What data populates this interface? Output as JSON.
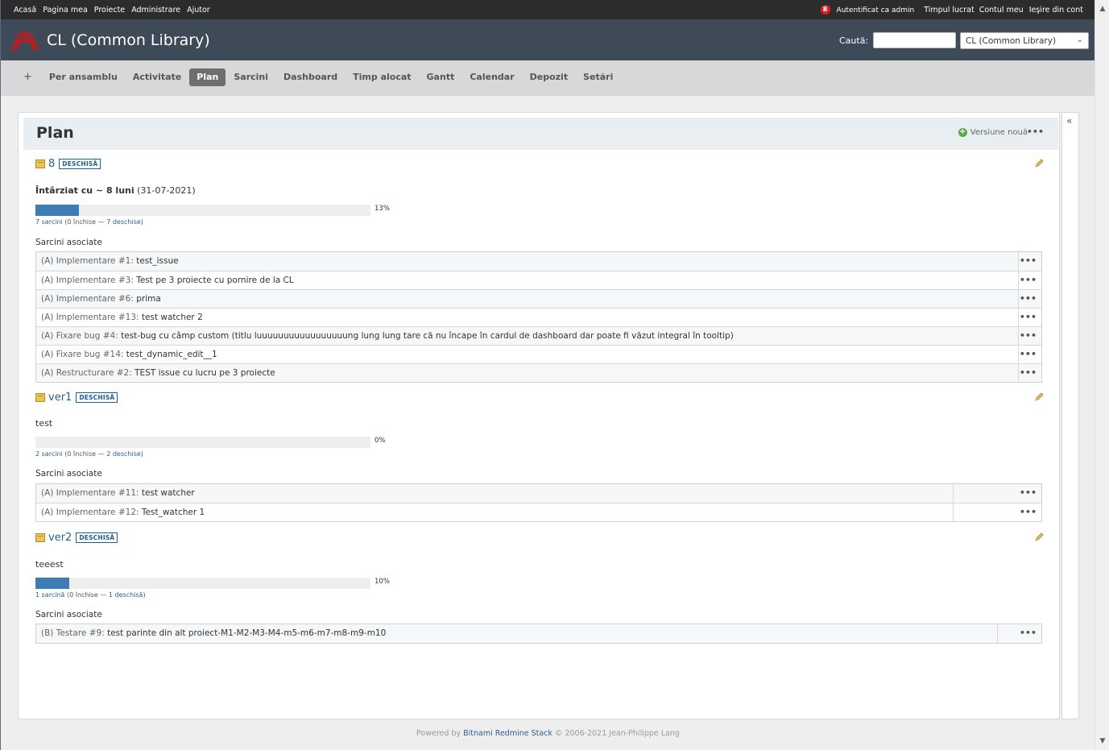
{
  "top_menu": {
    "left": [
      "Acasă",
      "Pagina mea",
      "Proiecte",
      "Administrare",
      "Ajutor"
    ],
    "notif_count": "8",
    "logged_as": "Autentificat ca admin",
    "right": [
      "Timpul lucrat",
      "Contul meu",
      "Ieşire din cont"
    ]
  },
  "header": {
    "title": "CL (Common Library)",
    "search_label": "Caută:",
    "project_select": "CL (Common Library)"
  },
  "main_menu": {
    "plus": "+",
    "tabs": [
      "Per ansamblu",
      "Activitate",
      "Plan",
      "Sarcini",
      "Dashboard",
      "Timp alocat",
      "Gantt",
      "Calendar",
      "Depozit",
      "Setări"
    ],
    "selected": "Plan"
  },
  "page": {
    "title": "Plan",
    "new_version": "Versiune nouă"
  },
  "versions": [
    {
      "name": "8",
      "status": "DESCHISĂ",
      "desc_bold": "Întârziat cu ~ 8 luni",
      "desc_rest": " (31-07-2021)",
      "progress": 13,
      "pct_label": "13%",
      "count_link": "7 sarcini",
      "count_mid": "  (0 închise — ",
      "count_open": "7 deschise",
      "count_end": ")",
      "related_label": "Sarcini asociate",
      "issues": [
        {
          "tracker": "(A) Implementare #1:",
          "subject": " test_issue"
        },
        {
          "tracker": "(A) Implementare #3:",
          "subject": " Test pe 3 proiecte cu pornire de la CL"
        },
        {
          "tracker": "(A) Implementare #6:",
          "subject": " prima"
        },
        {
          "tracker": "(A) Implementare #13:",
          "subject": " test watcher 2"
        },
        {
          "tracker": "(A) Fixare bug #4:",
          "subject": " test-bug cu câmp custom (titlu luuuuuuuuuuuuuuuuung lung lung tare că nu încape în cardul de dashboard dar poate fi văzut integral în tooltip)"
        },
        {
          "tracker": "(A) Fixare bug #14:",
          "subject": " test_dynamic_edit__1"
        },
        {
          "tracker": "(A) Restructurare #2:",
          "subject": " TEST issue cu lucru pe 3 proiecte"
        }
      ]
    },
    {
      "name": "ver1",
      "status": "DESCHISĂ",
      "desc_bold": "",
      "desc_rest": "test",
      "progress": 0,
      "pct_label": "0%",
      "count_link": "2 sarcini",
      "count_mid": "  (0 închise — ",
      "count_open": "2 deschise",
      "count_end": ")",
      "related_label": "Sarcini asociate",
      "issues": [
        {
          "tracker": "(A) Implementare #11:",
          "subject": " test watcher"
        },
        {
          "tracker": "(A) Implementare #12:",
          "subject": " Test_watcher 1"
        }
      ]
    },
    {
      "name": "ver2",
      "status": "DESCHISĂ",
      "desc_bold": "",
      "desc_rest": "teeest",
      "progress": 10,
      "pct_label": "10%",
      "count_link": "1 sarcină",
      "count_mid": "  (0 închise — ",
      "count_open": "1 deschisă",
      "count_end": ")",
      "related_label": "Sarcini asociate",
      "issues": [
        {
          "tracker": "(B) Testare #9:",
          "subject": " test parinte din alt proiect-M1-M2-M3-M4-m5-m6-m7-m8-m9-m10"
        }
      ]
    }
  ],
  "footer": {
    "pre": "Powered by ",
    "link": "Bitnami Redmine Stack",
    "post": " © 2006-2021 Jean-Philippe Lang"
  },
  "colors": {
    "header_bg": "#3e4a57",
    "progress_fill": "#3f7bb5",
    "link": "#2a5f8f"
  }
}
